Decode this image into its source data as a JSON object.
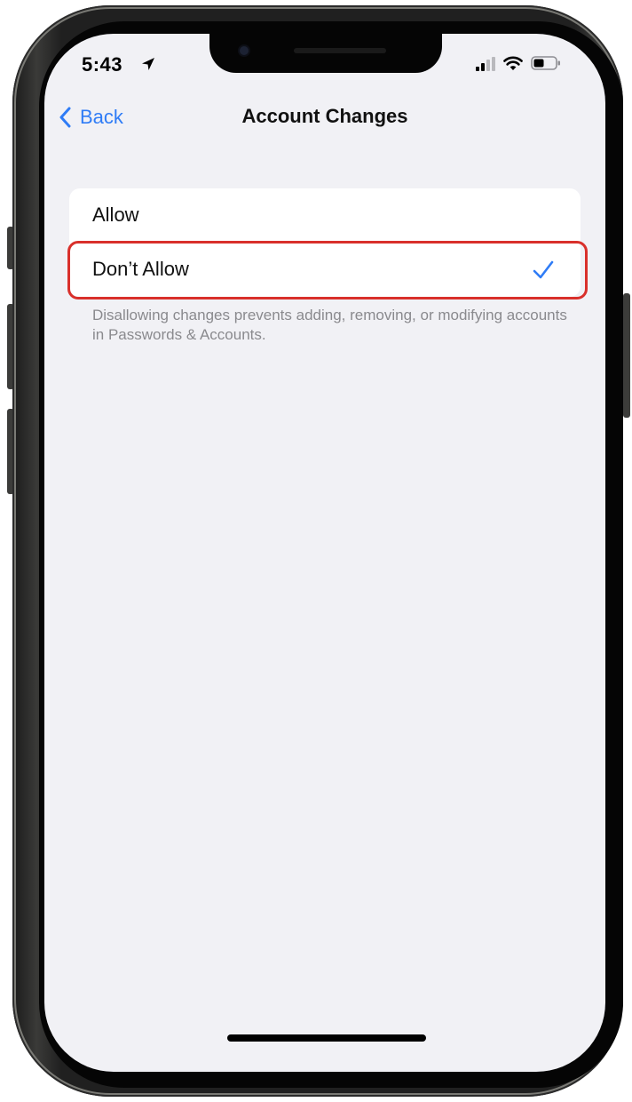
{
  "status_bar": {
    "time": "5:43",
    "location_icon": "location-arrow-icon",
    "signal_icon": "cellular-signal-icon",
    "wifi_icon": "wifi-icon",
    "battery_icon": "battery-icon"
  },
  "nav": {
    "back_label": "Back",
    "title": "Account Changes"
  },
  "options": [
    {
      "label": "Allow",
      "selected": false
    },
    {
      "label": "Don’t Allow",
      "selected": true
    }
  ],
  "footer_note": "Disallowing changes prevents adding, removing, or modifying accounts in Passwords & Accounts.",
  "colors": {
    "accent": "#2f7cf6",
    "highlight": "#d9302b",
    "background": "#f1f1f5"
  }
}
